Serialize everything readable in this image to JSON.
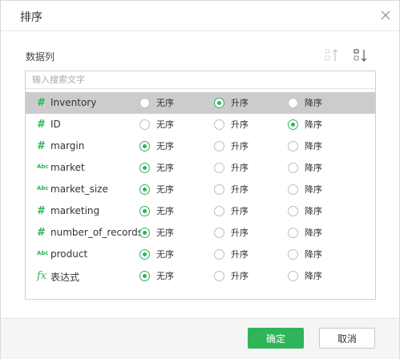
{
  "dialog": {
    "title": "排序",
    "section_label": "数据列",
    "search_placeholder": "输入搜索文字",
    "options": [
      "无序",
      "升序",
      "降序"
    ],
    "fields": [
      {
        "type_icon": "number",
        "name": "Inventory",
        "order": 1,
        "selected": true
      },
      {
        "type_icon": "number",
        "name": "ID",
        "order": 2,
        "selected": false
      },
      {
        "type_icon": "number",
        "name": "margin",
        "order": 0,
        "selected": false
      },
      {
        "type_icon": "text",
        "name": "market",
        "order": 0,
        "selected": false
      },
      {
        "type_icon": "text",
        "name": "market_size",
        "order": 0,
        "selected": false
      },
      {
        "type_icon": "number",
        "name": "marketing",
        "order": 0,
        "selected": false
      },
      {
        "type_icon": "number",
        "name": "number_of_records",
        "order": 0,
        "selected": false
      },
      {
        "type_icon": "text",
        "name": "product",
        "order": 0,
        "selected": false
      },
      {
        "type_icon": "formula",
        "name": "表达式",
        "order": 0,
        "selected": false
      }
    ],
    "ok_label": "确定",
    "cancel_label": "取消"
  },
  "icons": {
    "number": "#",
    "text": "Abc",
    "formula": "fx",
    "close": "close-icon",
    "sort_asc": "sort-ascending-icon",
    "sort_desc": "sort-descending-icon"
  },
  "colors": {
    "accent": "#2fb45a",
    "selected_row": "#cccccc",
    "footer_bg": "#f5f5f5"
  }
}
